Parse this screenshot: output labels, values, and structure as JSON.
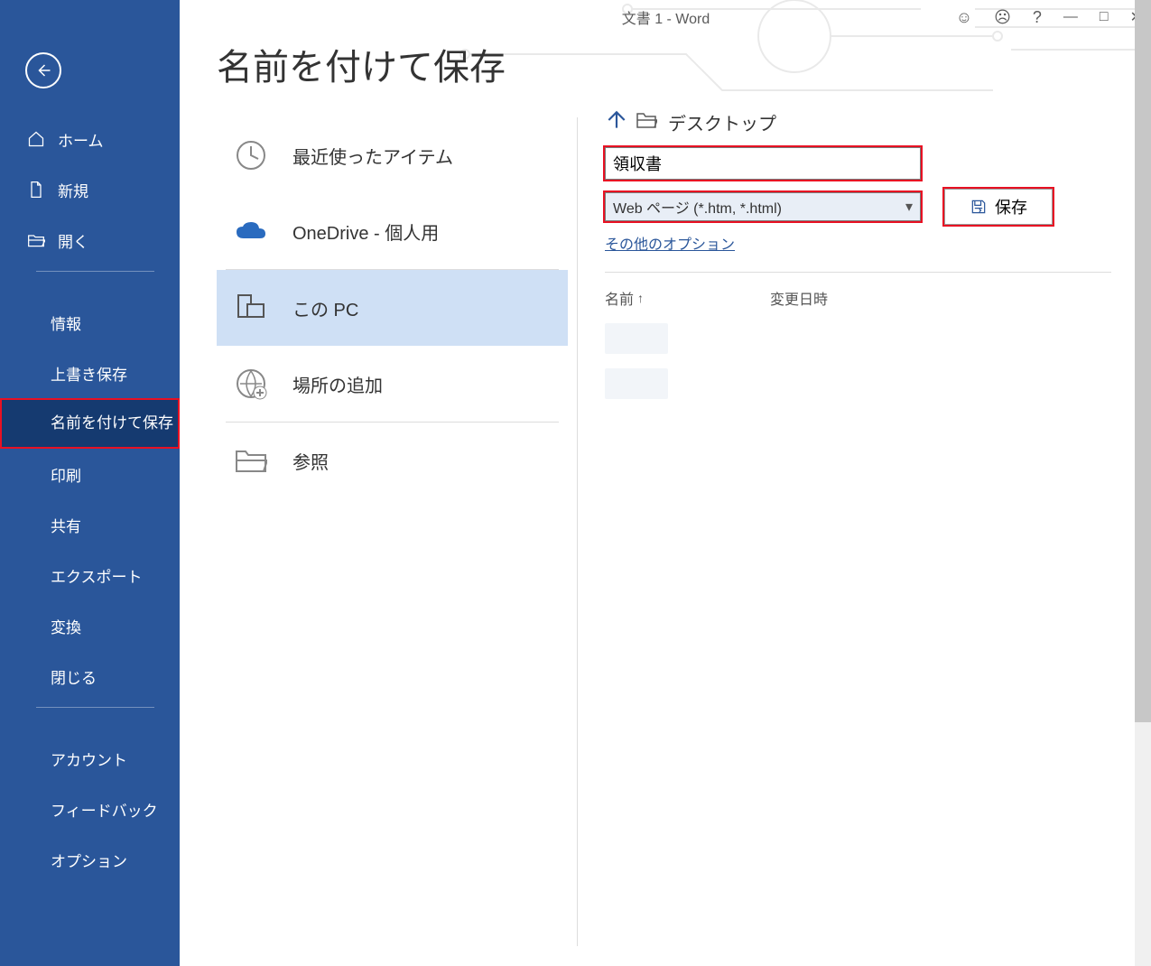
{
  "titlebar": {
    "document": "文書 1  -  Word"
  },
  "sidebar": {
    "back": "←",
    "primary": [
      {
        "icon": "home",
        "label": "ホーム"
      },
      {
        "icon": "newdoc",
        "label": "新規"
      },
      {
        "icon": "folder",
        "label": "開く"
      }
    ],
    "file_ops": [
      {
        "label": "情報"
      },
      {
        "label": "上書き保存"
      },
      {
        "label": "名前を付けて保存",
        "selected": true
      },
      {
        "label": "印刷"
      },
      {
        "label": "共有"
      },
      {
        "label": "エクスポート"
      },
      {
        "label": "変換"
      },
      {
        "label": "閉じる"
      }
    ],
    "bottom": [
      {
        "label": "アカウント"
      },
      {
        "label": "フィードバック"
      },
      {
        "label": "オプション"
      }
    ]
  },
  "page": {
    "title": "名前を付けて保存"
  },
  "locations": [
    {
      "icon": "clock",
      "label": "最近使ったアイテム"
    },
    {
      "icon": "onedrive",
      "label": "OneDrive - 個人用"
    },
    {
      "icon": "thispc",
      "label": "この PC",
      "selected": true
    },
    {
      "icon": "addplace",
      "label": "場所の追加"
    },
    {
      "icon": "browse",
      "label": "参照"
    }
  ],
  "detail": {
    "path": "デスクトップ",
    "filename": "領収書",
    "filetype": "Web ページ (*.htm, *.html)",
    "more_options": "その他のオプション",
    "save_label": "保存",
    "columns": {
      "name": "名前",
      "modified": "変更日時"
    }
  }
}
